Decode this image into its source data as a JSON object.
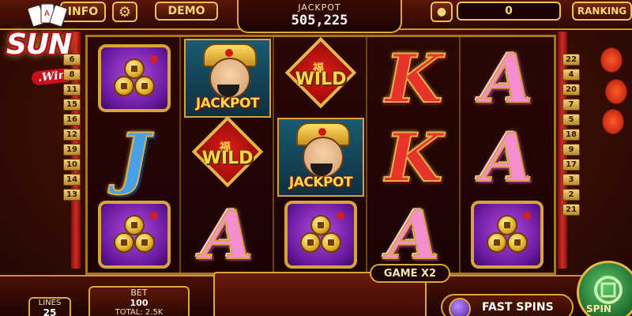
{
  "topbar": {
    "info_label": "INFO",
    "demo_label": "DEMO",
    "jackpot_label": "JACKPOT",
    "jackpot_value": "505,225",
    "balance_value": "0",
    "ranking_label": "RANKING"
  },
  "logo": {
    "text_main": "SUN",
    "text_sub": ".Win"
  },
  "lines_left": [
    "6",
    "8",
    "11",
    "15",
    "16",
    "12",
    "19",
    "10",
    "14",
    "13"
  ],
  "lines_right": [
    "22",
    "4",
    "20",
    "7",
    "5",
    "18",
    "9",
    "17",
    "3",
    "2",
    "21"
  ],
  "reels": [
    [
      "coins",
      "letter-J",
      "coins"
    ],
    [
      "jackpot",
      "wild",
      "letter-A"
    ],
    [
      "wild",
      "jackpot",
      "coins"
    ],
    [
      "letter-K",
      "letter-K",
      "letter-A"
    ],
    [
      "letter-A",
      "letter-A",
      "coins"
    ]
  ],
  "symbols": {
    "wild_text": "WILD",
    "jackpot_text": "JACKPOT",
    "letter_j": "J",
    "letter_k": "K",
    "letter_a": "A"
  },
  "bottombar": {
    "lines_label": "LINES",
    "lines_value": "25",
    "bet_label": "BET",
    "bet_value": "100",
    "total_label": "TOTAL",
    "total_value": "2.5K",
    "game_multiplier_label": "GAME X2",
    "fast_spins_label": "FAST SPINS",
    "spin_label": "SPIN"
  },
  "colors": {
    "gold": "#d9a73a",
    "deep_red": "#3b0d06",
    "pink_letter": "#f48ed0",
    "red_letter": "#e8322a",
    "blue_letter": "#4aa0e8",
    "purple_tile": "#6a1aa0"
  },
  "icons": [
    "settings-gear-icon",
    "info-icon",
    "spin-icon",
    "fast-spins-gem-icon",
    "playing-cards-icon"
  ]
}
